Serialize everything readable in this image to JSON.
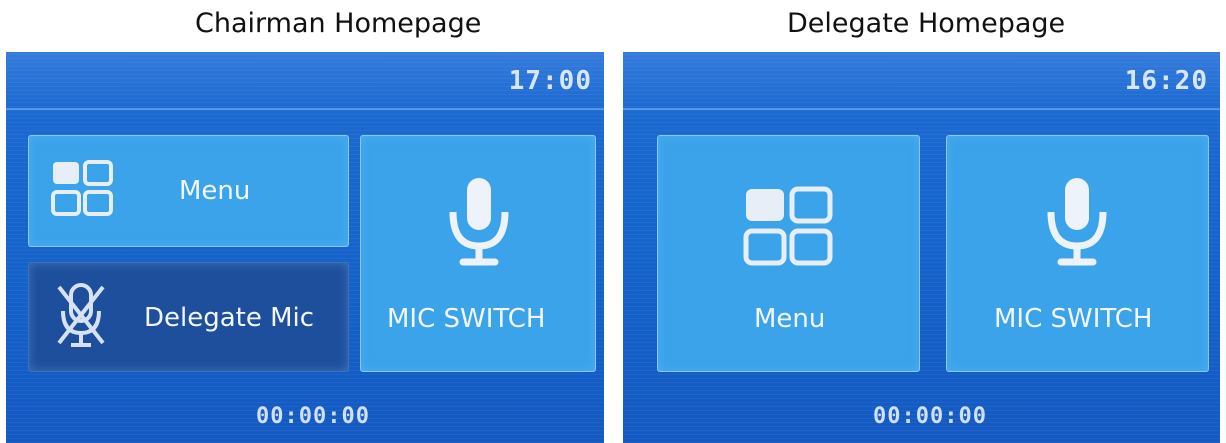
{
  "captions": {
    "chairman": "Chairman Homepage",
    "delegate": "Delegate Homepage"
  },
  "chairman": {
    "clock": "17:00",
    "menu_label": "Menu",
    "delegate_mic_label": "Delegate Mic",
    "mic_switch_label": "MIC SWITCH",
    "timer": "00:00:00"
  },
  "delegate": {
    "clock": "16:20",
    "menu_label": "Menu",
    "mic_switch_label": "MIC SWITCH",
    "timer": "00:00:00"
  },
  "icons": {
    "menu": "grid-menu-icon",
    "mic": "microphone-icon",
    "mic_off": "microphone-muted-icon"
  },
  "colors": {
    "screen_blue": "#1565cd",
    "tile_light": "#3aa3ea",
    "tile_dark": "#1e4f9c",
    "text_light": "#f2f7ff"
  }
}
